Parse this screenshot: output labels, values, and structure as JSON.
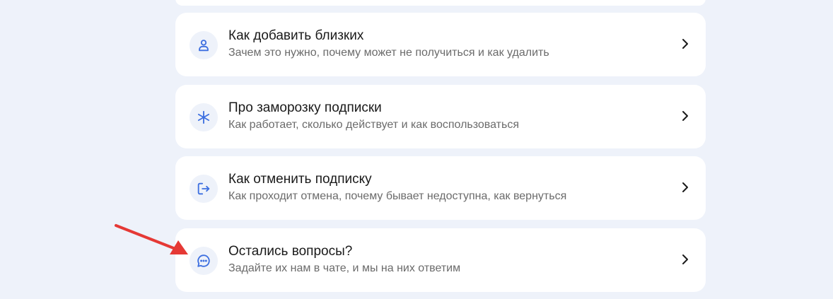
{
  "colors": {
    "accent": "#3d6fe0",
    "annotation": "#e53935",
    "background": "#eef2fa"
  },
  "items": [
    {
      "icon": "person-icon",
      "title": "Как добавить близких",
      "subtitle": "Зачем это нужно, почему может не получиться и как удалить"
    },
    {
      "icon": "snowflake-icon",
      "title": "Про заморозку подписки",
      "subtitle": "Как работает, сколько действует и как воспользоваться"
    },
    {
      "icon": "logout-icon",
      "title": "Как отменить подписку",
      "subtitle": "Как проходит отмена, почему бывает недоступна, как вернуться"
    },
    {
      "icon": "chat-icon",
      "title": "Остались вопросы?",
      "subtitle": "Задайте их нам в чате, и мы на них ответим"
    }
  ]
}
